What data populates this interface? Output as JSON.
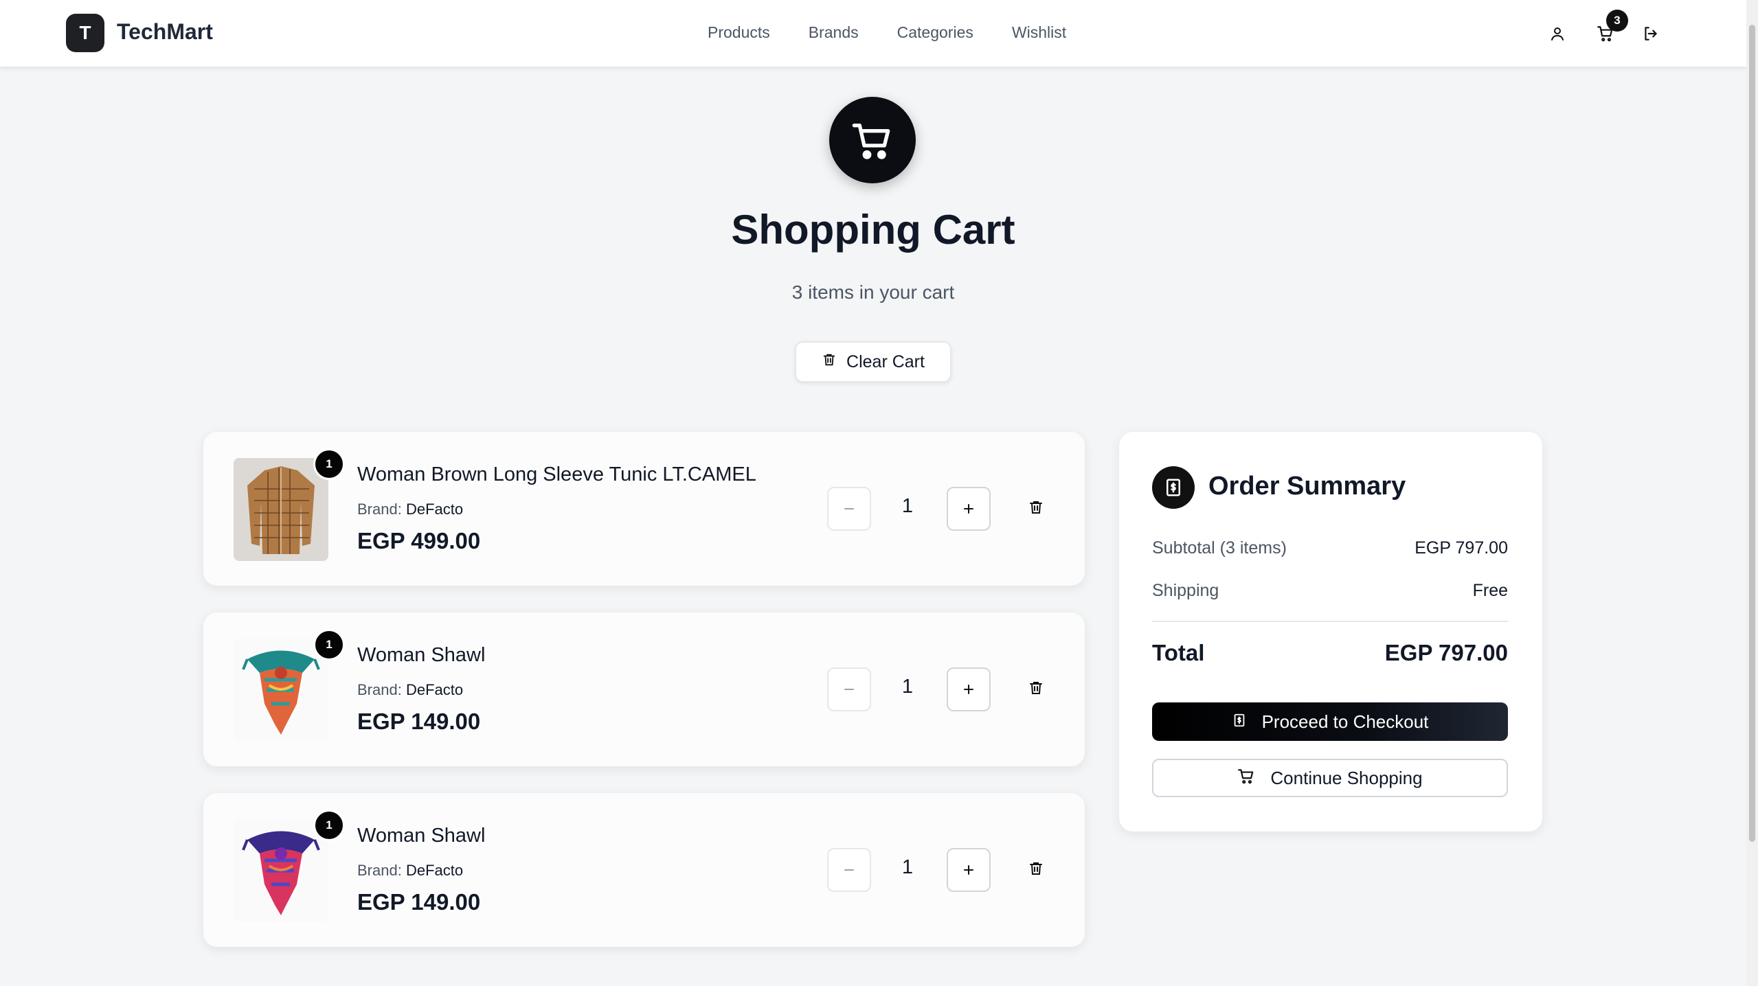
{
  "brand": {
    "logo_letter": "T",
    "name": "TechMart"
  },
  "nav": {
    "links": [
      "Products",
      "Brands",
      "Categories",
      "Wishlist"
    ],
    "cart_count": "3"
  },
  "header": {
    "title": "Shopping Cart",
    "subtitle": "3 items in your cart",
    "clear_label": "Clear Cart"
  },
  "items": [
    {
      "name": "Woman Brown Long Sleeve Tunic LT.CAMEL",
      "brand_label": "Brand:",
      "brand": "DeFacto",
      "price": "EGP 499.00",
      "quantity": "1",
      "badge": "1",
      "image_icon": "tunic-image"
    },
    {
      "name": "Woman Shawl",
      "brand_label": "Brand:",
      "brand": "DeFacto",
      "price": "EGP 149.00",
      "quantity": "1",
      "badge": "1",
      "image_icon": "shawl-image"
    },
    {
      "name": "Woman Shawl",
      "brand_label": "Brand:",
      "brand": "DeFacto",
      "price": "EGP 149.00",
      "quantity": "1",
      "badge": "1",
      "image_icon": "shawl-image"
    }
  ],
  "summary": {
    "title": "Order Summary",
    "subtotal_label": "Subtotal (3 items)",
    "subtotal_value": "EGP 797.00",
    "shipping_label": "Shipping",
    "shipping_value": "Free",
    "total_label": "Total",
    "total_value": "EGP 797.00",
    "checkout_label": "Proceed to Checkout",
    "continue_label": "Continue Shopping"
  },
  "colors": {
    "accent": "#0b0d12",
    "background": "#f4f5f6",
    "card": "#fcfcfc"
  }
}
